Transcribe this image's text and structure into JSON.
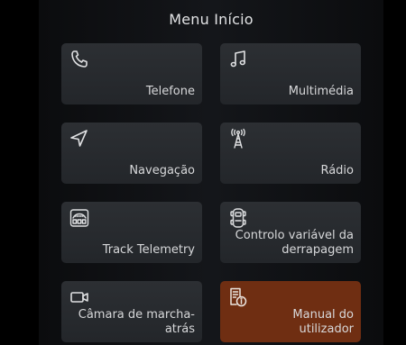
{
  "header": {
    "title": "Menu Início"
  },
  "tiles": [
    {
      "label": "Telefone",
      "icon": "phone-icon"
    },
    {
      "label": "Multimédia",
      "icon": "music-note-icon"
    },
    {
      "label": "Navegação",
      "icon": "navigation-arrow-icon"
    },
    {
      "label": "Rádio",
      "icon": "radio-antenna-icon"
    },
    {
      "label": "Track Telemetry",
      "icon": "telemetry-gauge-icon"
    },
    {
      "label": "Controlo variável da derrapagem",
      "icon": "drift-control-icon"
    },
    {
      "label": "Câmara de marcha-atrás",
      "icon": "camera-icon"
    },
    {
      "label": "Manual do utilizador",
      "icon": "manual-info-icon"
    }
  ],
  "colors": {
    "tile": "#2a2d31",
    "highlight": "#6f2e12",
    "text": "#d7d8da"
  }
}
